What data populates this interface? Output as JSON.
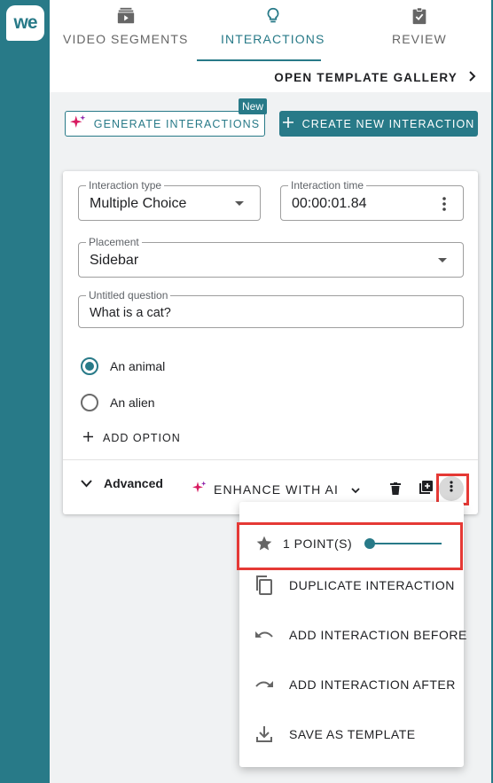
{
  "brand": {
    "logo_text": "we"
  },
  "tabs": [
    {
      "label": "VIDEO SEGMENTS",
      "icon": "video-segments-icon",
      "active": false
    },
    {
      "label": "INTERACTIONS",
      "icon": "lightbulb-icon",
      "active": true
    },
    {
      "label": "REVIEW",
      "icon": "clipboard-check-icon",
      "active": false
    }
  ],
  "gallery": {
    "label": "OPEN TEMPLATE GALLERY"
  },
  "actions": {
    "generate_label": "GENERATE INTERACTIONS",
    "new_badge": "New",
    "create_label": "CREATE NEW INTERACTION"
  },
  "interaction": {
    "type_label": "Interaction type",
    "type_value": "Multiple Choice",
    "time_label": "Interaction time",
    "time_value": "00:00:01.84",
    "placement_label": "Placement",
    "placement_value": "Sidebar",
    "question_label": "Untitled question",
    "question_value": "What is a cat?",
    "options": [
      {
        "label": "An animal",
        "checked": true
      },
      {
        "label": "An alien",
        "checked": false
      }
    ],
    "add_option_label": "ADD OPTION",
    "advanced_label": "Advanced",
    "enhance_label": "ENHANCE WITH AI"
  },
  "menu": {
    "points_label": "1 POINT(S)",
    "points_value": 1,
    "items": [
      {
        "label": "DUPLICATE INTERACTION",
        "icon": "copy-icon"
      },
      {
        "label": "ADD INTERACTION BEFORE",
        "icon": "undo-arrow-icon"
      },
      {
        "label": "ADD INTERACTION AFTER",
        "icon": "redo-arrow-icon"
      },
      {
        "label": "SAVE AS TEMPLATE",
        "icon": "download-tray-icon"
      }
    ]
  },
  "colors": {
    "accent": "#287a88",
    "highlight": "#e53935",
    "sparkle": "#d81b60"
  }
}
